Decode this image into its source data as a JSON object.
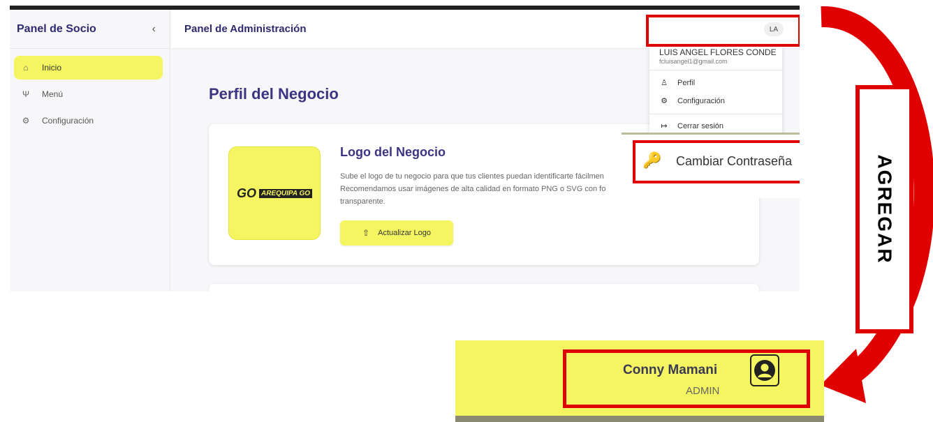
{
  "sidebar": {
    "title": "Panel de Socio",
    "collapse_icon": "‹",
    "items": [
      {
        "label": "Inicio",
        "icon": "home-icon",
        "active": true
      },
      {
        "label": "Menú",
        "icon": "utensils-icon",
        "active": false
      },
      {
        "label": "Configuración",
        "icon": "gear-icon",
        "active": false
      }
    ]
  },
  "header": {
    "title": "Panel de Administración",
    "avatar_initials": "LA"
  },
  "main": {
    "page_title": "Perfil del Negocio",
    "card": {
      "title": "Logo del Negocio",
      "description": "Sube el logo de tu negocio para que tus clientes puedan identificarte fácilmen Recomendamos usar imágenes de alta calidad en formato PNG o SVG con fo transparente.",
      "logo_text": "AREQUIPA GO",
      "logo_mark": "GO",
      "button_label": "Actualizar Logo"
    }
  },
  "user_menu": {
    "name": "LUIS ANGEL FLORES CONDE",
    "email": "fcluisangel1@gmail.com",
    "items": [
      {
        "label": "Perfil",
        "icon": "user-icon"
      },
      {
        "label": "Configuración",
        "icon": "gear-icon"
      },
      {
        "label": "Cerrar sesión",
        "icon": "logout-icon"
      }
    ]
  },
  "change_password": {
    "label": "Cambiar Contraseña",
    "icon": "key-icon"
  },
  "annotation": {
    "text": "AGREGAR",
    "color": "#e00000"
  },
  "user_badge": {
    "name": "Conny Mamani",
    "role": "ADMIN",
    "icon": "user-circle-icon"
  },
  "colors": {
    "accent": "#f5f562",
    "brand": "#3a3580",
    "annotation_red": "#e00000"
  }
}
